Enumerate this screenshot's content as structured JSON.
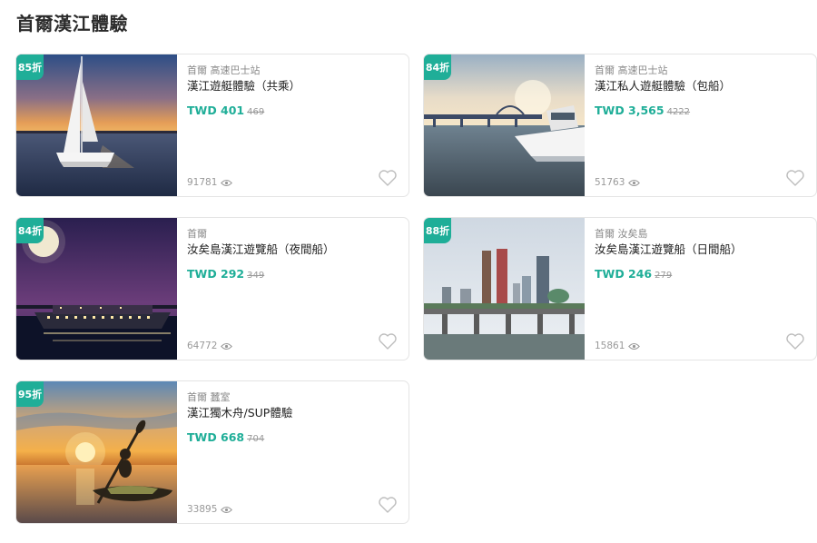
{
  "page": {
    "title": "首爾漢江體驗"
  },
  "colors": {
    "accent": "#1fae98",
    "muted": "#999999"
  },
  "cards": [
    {
      "badge": "85折",
      "location": "首爾 高速巴士站",
      "title": "漢江遊艇體驗（共乘）",
      "price": "TWD 401",
      "original_price": "469",
      "views": "91781"
    },
    {
      "badge": "84折",
      "location": "首爾 高速巴士站",
      "title": "漢江私人遊艇體驗（包船）",
      "price": "TWD 3,565",
      "original_price": "4222",
      "views": "51763"
    },
    {
      "badge": "84折",
      "location": "首爾",
      "title": "汝矣島漢江遊覽船（夜間船）",
      "price": "TWD 292",
      "original_price": "349",
      "views": "64772"
    },
    {
      "badge": "88折",
      "location": "首爾 汝矣島",
      "title": "汝矣島漢江遊覽船（日間船）",
      "price": "TWD 246",
      "original_price": "279",
      "views": "15861"
    },
    {
      "badge": "95折",
      "location": "首爾 蠶室",
      "title": "漢江獨木舟/SUP體驗",
      "price": "TWD 668",
      "original_price": "704",
      "views": "33895"
    }
  ]
}
